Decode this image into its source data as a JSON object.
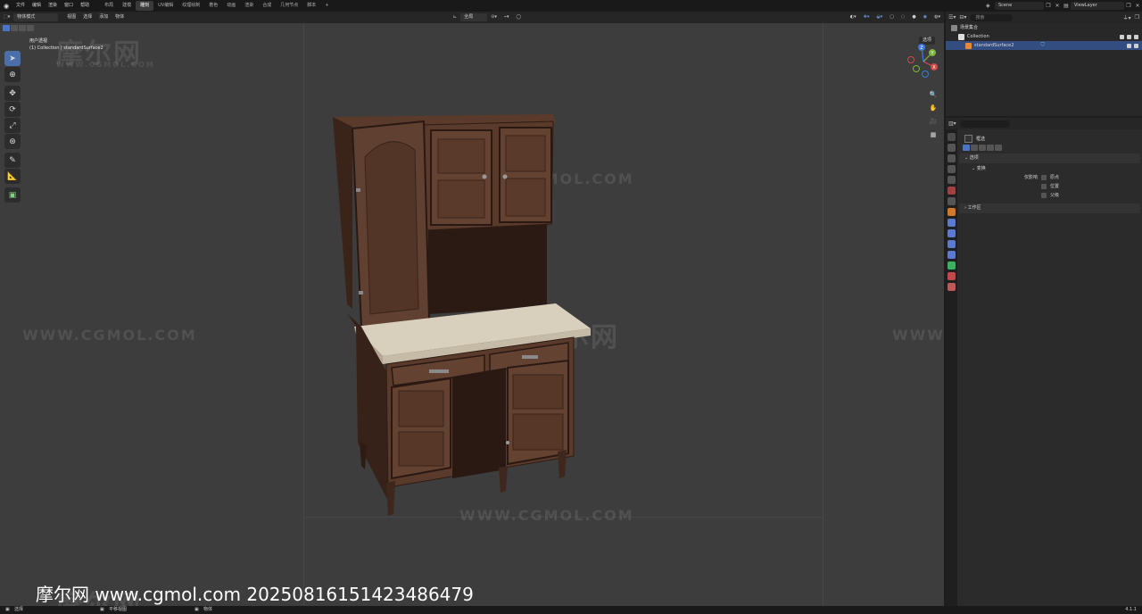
{
  "top_menu": {
    "menus": [
      "文件",
      "编辑",
      "渲染",
      "窗口",
      "帮助"
    ],
    "workspaces": [
      "布局",
      "建模",
      "雕刻",
      "UV编辑",
      "纹理绘制",
      "着色",
      "动画",
      "渲染",
      "合成",
      "几何节点",
      "脚本"
    ],
    "active_workspace_index": 2,
    "add_tab": "+",
    "scene": "Scene",
    "view_layer": "ViewLayer"
  },
  "viewport": {
    "mode": "物体模式",
    "header_menus": [
      "视图",
      "选择",
      "添加",
      "物体"
    ],
    "transform_orientation": "全局",
    "options": "选项",
    "view_name": "用户透视",
    "view_info": "(1) Collection | standardSurface2",
    "gizmo_axes": [
      "X",
      "Y",
      "Z"
    ]
  },
  "watermarks": {
    "logo_cn": "摩尔网",
    "site": "WWW.CGMOL.COM",
    "footer": "摩尔网 www.cgmol.com 20250816151423486479"
  },
  "outliner": {
    "search_placeholder": "搜索",
    "rows": [
      "场景集合",
      "Collection",
      "standardSurface2"
    ]
  },
  "properties": {
    "search_placeholder": "",
    "tool_name": "框选",
    "section_options": "选项",
    "sub_transform": "变换",
    "affect_only_label": "仅影响",
    "affect_items": [
      "原点",
      "位置",
      "父级"
    ],
    "section_workspace": "工作区"
  },
  "statusbar": {
    "left": "选择",
    "middle": "平移视图",
    "right": "物体",
    "version": "4.1.1"
  },
  "colors": {
    "viewport_bg": "#3d3d3d",
    "accent_blue": "#4b6fa8",
    "panel_bg": "#2b2b2b",
    "wood_dark": "#4a3024",
    "wood_mid": "#5e3e2e",
    "marble": "#d8cfbd"
  }
}
